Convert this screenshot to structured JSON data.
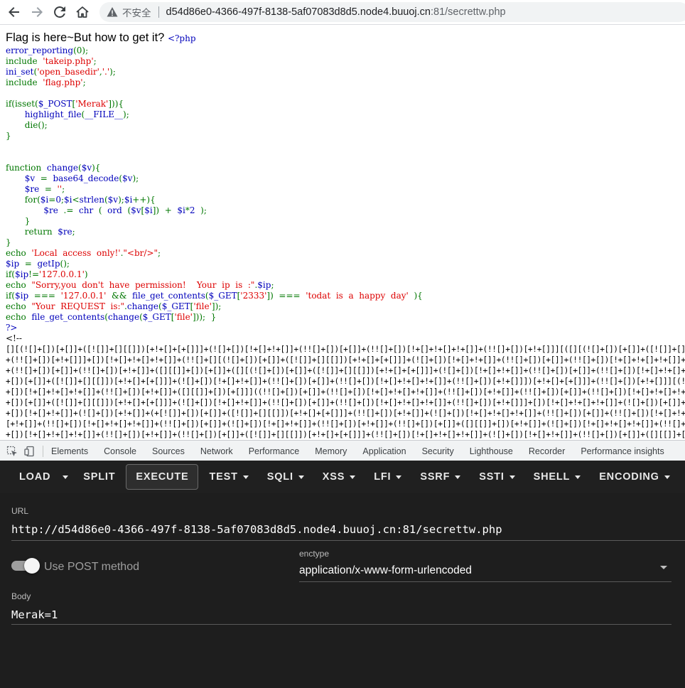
{
  "browser": {
    "insecure_label": "不安全",
    "url_host": "d54d86e0-4366-497f-8138-5af07083d8d5.node4.buuoj.cn",
    "url_rest": ":81/secrettw.php"
  },
  "page": {
    "flag_text": "Flag is here~But how to get it?",
    "php_open": "<?php",
    "code_lines": [
      [
        [
          "c-def",
          "error_reporting"
        ],
        [
          "c-kw",
          "(0);"
        ]
      ],
      [
        [
          "c-kw",
          "include  "
        ],
        [
          "c-str",
          "'takeip.php'"
        ],
        [
          "c-kw",
          ";"
        ]
      ],
      [
        [
          "c-def",
          "ini_set"
        ],
        [
          "c-kw",
          "("
        ],
        [
          "c-str",
          "'open_basedir'"
        ],
        [
          "c-kw",
          ","
        ],
        [
          "c-str",
          "'.'"
        ],
        [
          "c-kw",
          ");"
        ]
      ],
      [
        [
          "c-kw",
          "include  "
        ],
        [
          "c-str",
          "'flag.php'"
        ],
        [
          "c-kw",
          ";"
        ]
      ],
      [],
      [
        [
          "c-kw",
          "if(isset("
        ],
        [
          "c-def",
          "$_POST"
        ],
        [
          "c-kw",
          "["
        ],
        [
          "c-str",
          "'Merak'"
        ],
        [
          "c-kw",
          "])){"
        ]
      ],
      [
        [
          "c-kw",
          "       "
        ],
        [
          "c-def",
          "highlight_file"
        ],
        [
          "c-kw",
          "("
        ],
        [
          "c-def",
          "__FILE__"
        ],
        [
          "c-kw",
          ");"
        ]
      ],
      [
        [
          "c-kw",
          "       die();"
        ]
      ],
      [
        [
          "c-kw",
          "}"
        ]
      ],
      [],
      [],
      [
        [
          "c-kw",
          "function  "
        ],
        [
          "c-def",
          "change"
        ],
        [
          "c-kw",
          "("
        ],
        [
          "c-def",
          "$v"
        ],
        [
          "c-kw",
          "){"
        ]
      ],
      [
        [
          "c-kw",
          "       "
        ],
        [
          "c-def",
          "$v  "
        ],
        [
          "c-kw",
          "=  "
        ],
        [
          "c-def",
          "base64_decode"
        ],
        [
          "c-kw",
          "("
        ],
        [
          "c-def",
          "$v"
        ],
        [
          "c-kw",
          ");"
        ]
      ],
      [
        [
          "c-kw",
          "       "
        ],
        [
          "c-def",
          "$re  "
        ],
        [
          "c-kw",
          "=  "
        ],
        [
          "c-str",
          "''"
        ],
        [
          "c-kw",
          ";"
        ]
      ],
      [
        [
          "c-kw",
          "       for("
        ],
        [
          "c-def",
          "$i"
        ],
        [
          "c-kw",
          "="
        ],
        [
          "c-def",
          "0"
        ],
        [
          "c-kw",
          ";"
        ],
        [
          "c-def",
          "$i"
        ],
        [
          "c-kw",
          "<"
        ],
        [
          "c-def",
          "strlen"
        ],
        [
          "c-kw",
          "("
        ],
        [
          "c-def",
          "$v"
        ],
        [
          "c-kw",
          ");"
        ],
        [
          "c-def",
          "$i"
        ],
        [
          "c-kw",
          "++){"
        ]
      ],
      [
        [
          "c-kw",
          "              "
        ],
        [
          "c-def",
          "$re  "
        ],
        [
          "c-kw",
          ".=  "
        ],
        [
          "c-def",
          "chr  "
        ],
        [
          "c-kw",
          "(  "
        ],
        [
          "c-def",
          "ord  "
        ],
        [
          "c-kw",
          "("
        ],
        [
          "c-def",
          "$v"
        ],
        [
          "c-kw",
          "["
        ],
        [
          "c-def",
          "$i"
        ],
        [
          "c-kw",
          "])  +  "
        ],
        [
          "c-def",
          "$i"
        ],
        [
          "c-kw",
          "*"
        ],
        [
          "c-def",
          "2  "
        ],
        [
          "c-kw",
          ");"
        ]
      ],
      [
        [
          "c-kw",
          "       }"
        ]
      ],
      [
        [
          "c-kw",
          "       return  "
        ],
        [
          "c-def",
          "$re"
        ],
        [
          "c-kw",
          ";"
        ]
      ],
      [
        [
          "c-kw",
          "}"
        ]
      ],
      [
        [
          "c-kw",
          "echo  "
        ],
        [
          "c-str",
          "'Local  access  only!'"
        ],
        [
          "c-kw",
          "."
        ],
        [
          "c-str",
          "\"<br/>\""
        ],
        [
          "c-kw",
          ";"
        ]
      ],
      [
        [
          "c-def",
          "$ip  "
        ],
        [
          "c-kw",
          "=  "
        ],
        [
          "c-def",
          "getIp"
        ],
        [
          "c-kw",
          "();"
        ]
      ],
      [
        [
          "c-kw",
          "if("
        ],
        [
          "c-def",
          "$ip"
        ],
        [
          "c-kw",
          "!="
        ],
        [
          "c-str",
          "'127.0.0.1'"
        ],
        [
          "c-kw",
          ")"
        ]
      ],
      [
        [
          "c-kw",
          "echo  "
        ],
        [
          "c-str",
          "\"Sorry,you  don't  have  permission!    Your  ip  is  :\""
        ],
        [
          "c-kw",
          "."
        ],
        [
          "c-def",
          "$ip"
        ],
        [
          "c-kw",
          ";"
        ]
      ],
      [
        [
          "c-kw",
          "if("
        ],
        [
          "c-def",
          "$ip  "
        ],
        [
          "c-kw",
          "===  "
        ],
        [
          "c-str",
          "'127.0.0.1'  "
        ],
        [
          "c-kw",
          "&&  "
        ],
        [
          "c-def",
          "file_get_contents"
        ],
        [
          "c-kw",
          "("
        ],
        [
          "c-def",
          "$_GET"
        ],
        [
          "c-kw",
          "["
        ],
        [
          "c-str",
          "'2333'"
        ],
        [
          "c-kw",
          "])  ===  "
        ],
        [
          "c-str",
          "'todat  is  a  happy  day'  "
        ],
        [
          "c-kw",
          "){"
        ]
      ],
      [
        [
          "c-kw",
          "echo  "
        ],
        [
          "c-str",
          "\"Your  REQUEST  is:\""
        ],
        [
          "c-kw",
          "."
        ],
        [
          "c-def",
          "change"
        ],
        [
          "c-kw",
          "("
        ],
        [
          "c-def",
          "$_GET"
        ],
        [
          "c-kw",
          "["
        ],
        [
          "c-str",
          "'file'"
        ],
        [
          "c-kw",
          "]);"
        ]
      ],
      [
        [
          "c-kw",
          "echo  "
        ],
        [
          "c-def",
          "file_get_contents"
        ],
        [
          "c-kw",
          "("
        ],
        [
          "c-def",
          "change"
        ],
        [
          "c-kw",
          "("
        ],
        [
          "c-def",
          "$_GET"
        ],
        [
          "c-kw",
          "["
        ],
        [
          "c-str",
          "'file'"
        ],
        [
          "c-kw",
          "]));  }"
        ]
      ],
      [
        [
          "c-def",
          "?>"
        ]
      ],
      [
        [
          "c-cmt",
          "<!--"
        ]
      ]
    ],
    "jsfuck_lines": [
      "[][(![]+[])[+[]]+([![]]+[][[]])[+!+[]+[+[]]]+(![]+[])[!+[]+!+[]]+(!![]+[])[+[]]+(!![]+[])[!+[]+!+[]+!+[]]+(!![]+[])[+!+[]]][([][(![]+[])[+[]]+([![]]+[][[]])[+!+[]+[+[]]]+(![]+[])[!+[]+!+[]]+(!![]+[])[+[]]+(!![]+[])[!+[]+!+[]+!+[]]",
      "+(!![]+[])[+!+[]]]+[])[!+[]+!+[]+!+[]]+(!![]+[][(![]+[])[+[]]+([![]]+[][[]])[+!+[]+[+[]]]+(![]+[])[!+[]+!+[]]+(!![]+[])[+[]]+(!![]+[])[!+[]+!+[]+!+[]]+(!![]+[])[+!+[]]])[+!+[]+[+[]]]+([][[]]+[])[+!+[]]+(![]+[])[!+[]+!+[]+!+[]]",
      "+(!![]+[])[+[]]+(!![]+[])[+!+[]]+([][[]]+[])[+[]]+([][(![]+[])[+[]]+([![]]+[][[]])[+!+[]+[+[]]]+(![]+[])[!+[]+!+[]]+(!![]+[])[+[]]+(!![]+[])[!+[]+!+[]+!+[]]+(!![]+[])[+!+[]]]+[])[!+[]+!+[]+!+[]]+(!![]+[])[+[]]+(!![]+[][(![]",
      "+[])[+[]]+([![]]+[][[]])[+!+[]+[+[]]]+(![]+[])[!+[]+!+[]]+(!![]+[])[+[]]+(!![]+[])[!+[]+!+[]+!+[]]+(!![]+[])[+!+[]]])[+!+[]+[+[]]]+(!![]+[])[+!+[]]][(!![]+[])[!+[]+!+[]+!+[]]+(+(!+[]+!+[]+[+!+[]]+[+!+[]]))[(!![]+[])[+[]]+(!![]",
      "+[])[!+[]+!+[]+!+[]]+(!![]+[])[+!+[]]+([][[]]+[])[+[]]]((!![]+[])[+[]]+(!![]+[])[!+[]+!+[]+!+[]]+(!![]+[])[+!+[]]+(!![]+[])[+[]]+(!![]+[])[!+[]+!+[]+!+[]]+(!![]+[])[+!+[]]+([][[]]+[])[+[]]+(!![]+[])[+[]]+(![]+[])[!+[]+!+[]]+(!![]",
      "+[])[+[]]+([![]]+[][[]])[+!+[]+[+[]]]+(![]+[])[!+[]+!+[]]+(!![]+[])[+[]]+(!![]+[])[!+[]+!+[]+!+[]]+(!![]+[])[+!+[]]]+[])[!+[]+!+[]+!+[]]+(![]+[])[+[]]+(![]+[])[!+[]+!+[]]+(!![]+[])[+[]]+(!![]+[])[+!+[]]+([][[]]+[])[+!+[]]+(![]",
      "+[])[!+[]+!+[]]+(![]+[])[+!+[]]+(+[![]]+[])[+[]]+([![]]+[][[]])[+!+[]+[+[]]]+(!![]+[])[+!+[]]+(![]+[])[!+[]+!+[]+!+[]]+(!![]+[])[+[]]+(!![]+[])[!+[]+!+[]+!+[]]+([][[]]+[])[+!+[]]+(![]+[])[!+[]+!+[]+!+[]]+(!![]+[])[+[]]+(![]+[])",
      "[+!+[]]+(!![]+[])[!+[]+!+[]+!+[]]+(!![]+[])[+[]]+(![]+[])[!+[]+!+[]]+(!![]+[])[+!+[]]+(!![]+[])[+[]]+([][[]]+[])[+!+[]]+(![]+[])[!+[]+!+[]+!+[]]+(!![]+[])[+[]]+(![]+[])[!+[]+!+[]]+(!![]+[])[+!+[]]+(!![]+[])[+[]]+(!![]+[])[+!+[]]",
      "+[])[!+[]+!+[]+!+[]]+(!![]+[])[+!+[]]+(!![]+[])[+[]]+([![]]+[][[]])[+!+[]+[+[]]]+(!![]+[])[!+[]+!+[]+!+[]]+(![]+[])[!+[]+!+[]]+(!![]+[])[+[]]+([][[]]+[])[+!+[]]+(![]+[])[+!+[]]+(!![]+[])[!+[]+!+[]+!+[]]+(!![]+[])[+[]]+(![]+[])"
    ]
  },
  "devtools": {
    "tabs": [
      "Elements",
      "Console",
      "Sources",
      "Network",
      "Performance",
      "Memory",
      "Application",
      "Security",
      "Lighthouse",
      "Recorder",
      "Performance insights"
    ]
  },
  "hackbar": {
    "buttons": [
      {
        "label": "LOAD",
        "dropdown": false,
        "active": false
      },
      {
        "label": "",
        "dropdown": true,
        "active": false
      },
      {
        "label": "SPLIT",
        "dropdown": false,
        "active": false
      },
      {
        "label": "EXECUTE",
        "dropdown": false,
        "active": true
      },
      {
        "label": "TEST",
        "dropdown": true,
        "active": false
      },
      {
        "label": "SQLI",
        "dropdown": true,
        "active": false
      },
      {
        "label": "XSS",
        "dropdown": true,
        "active": false
      },
      {
        "label": "LFI",
        "dropdown": true,
        "active": false
      },
      {
        "label": "SSRF",
        "dropdown": true,
        "active": false
      },
      {
        "label": "SSTI",
        "dropdown": true,
        "active": false
      },
      {
        "label": "SHELL",
        "dropdown": true,
        "active": false
      },
      {
        "label": "ENCODING",
        "dropdown": true,
        "active": false
      }
    ],
    "url_label": "URL",
    "url_value": "http://d54d86e0-4366-497f-8138-5af07083d8d5.node4.buuoj.cn:81/secrettw.php",
    "post_label": "Use POST method",
    "post_enabled": true,
    "enctype_label": "enctype",
    "enctype_value": "application/x-www-form-urlencoded",
    "body_label": "Body",
    "body_value": "Merak=1"
  }
}
